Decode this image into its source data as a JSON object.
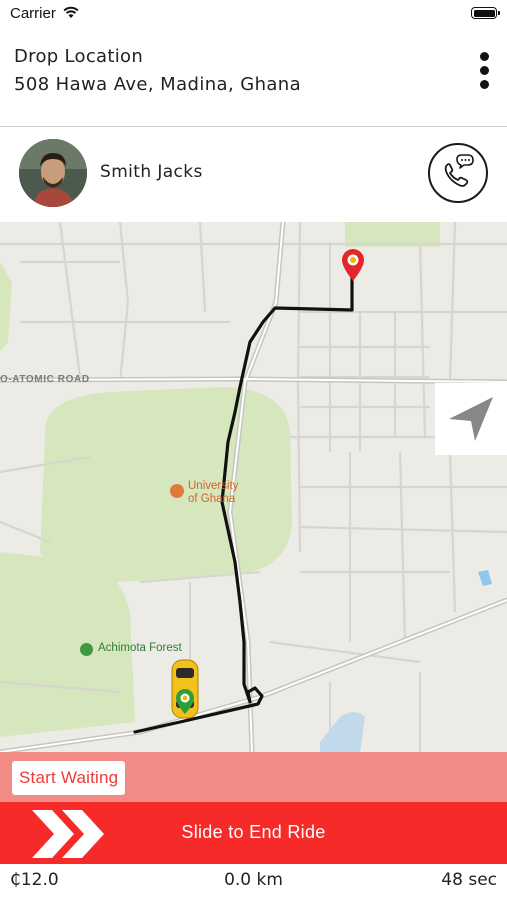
{
  "status_bar": {
    "carrier": "Carrier"
  },
  "drop": {
    "title": "Drop Location",
    "address": "508 Hawa Ave, Madina, Ghana"
  },
  "driver": {
    "name": "Smith Jacks"
  },
  "map": {
    "road_label": "O-ATOMIC ROAD",
    "poi_university_line1": "University",
    "poi_university_line2": "of Ghana",
    "poi_forest": "Achimota Forest"
  },
  "actions": {
    "start_waiting": "Start Waiting",
    "slide_label": "Slide to End Ride"
  },
  "stats": {
    "fare": "₵12.0",
    "distance": "0.0 km",
    "duration": "48 sec"
  },
  "colors": {
    "accent_red": "#f72a2a",
    "strip_pink": "#f28b85",
    "route": "#111111",
    "park_green": "#d6e7be"
  },
  "icons": [
    "wifi-icon",
    "battery-icon",
    "more-vertical-icon",
    "phone-chat-icon",
    "navigation-arrow-icon",
    "destination-pin-icon",
    "taxi-car-icon",
    "chevron-right-double-icon"
  ]
}
